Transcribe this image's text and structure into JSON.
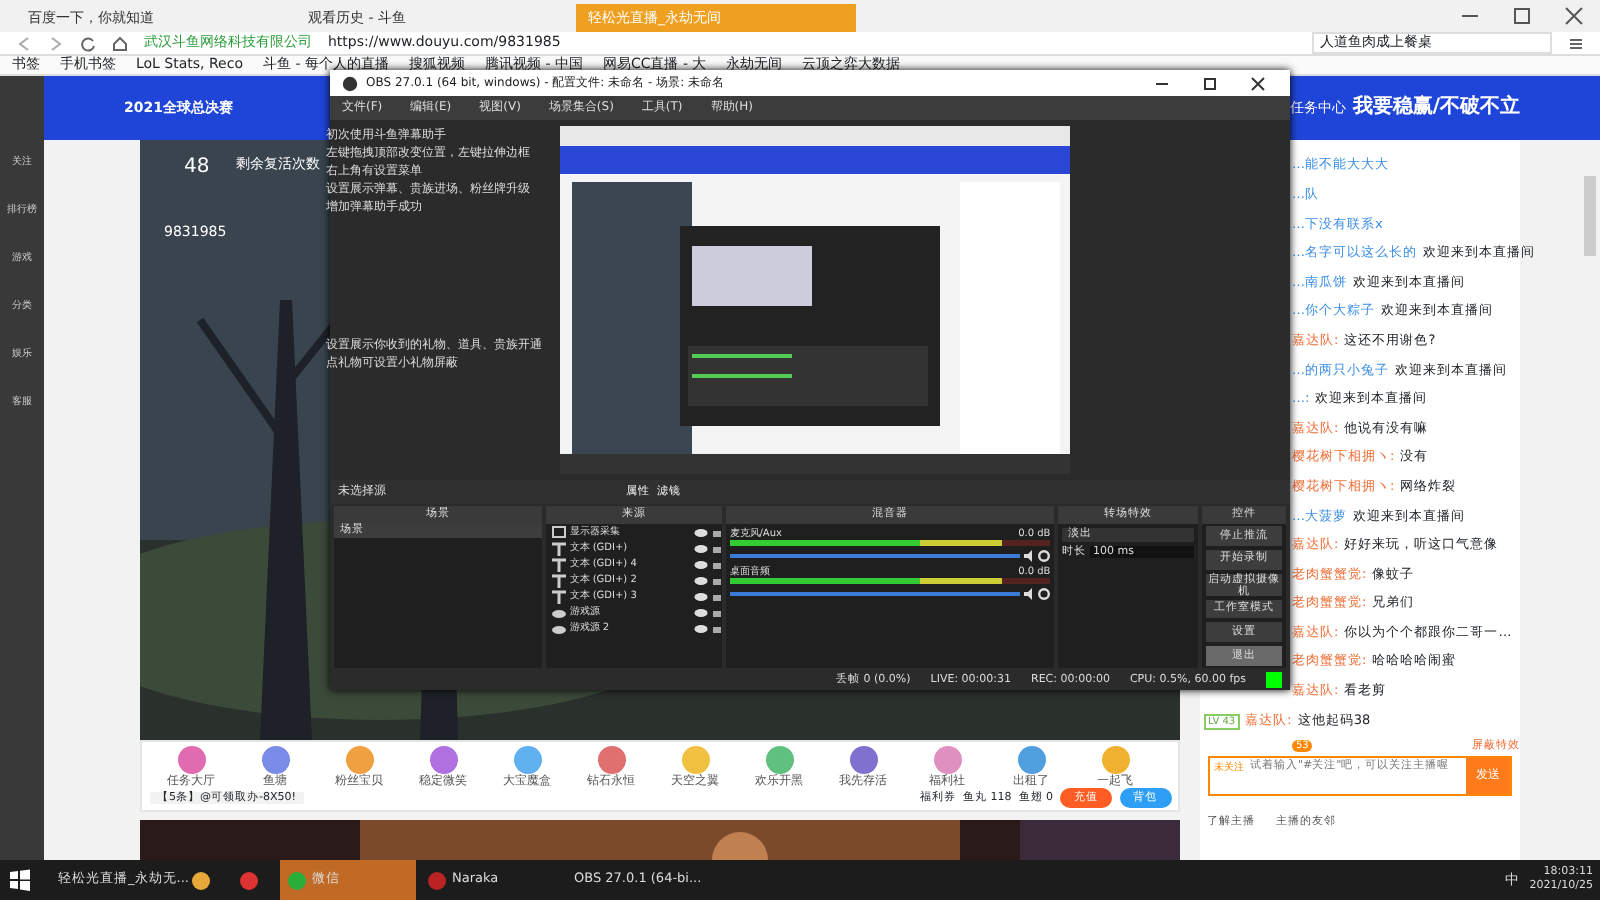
{
  "browser": {
    "tabs": [
      {
        "label": "百度一下，你就知道",
        "selected": false
      },
      {
        "label": "观看历史 - 斗鱼",
        "selected": false
      },
      {
        "label": "轻松光直播_永劫无间",
        "selected": true
      }
    ],
    "company": "武汉斗鱼网络科技有限公司",
    "url": "https://www.douyu.com/9831985",
    "search": "人道鱼肉成上餐桌",
    "bookmarks": [
      "书签",
      "手机书签",
      "LoL Stats, Reco",
      "斗鱼 - 每个人的直播",
      "搜狐视频",
      "腾讯视频 - 中国",
      "网易CC直播 - 大",
      "永劫无间",
      "云顶之弈大数据"
    ]
  },
  "sidebar": [
    "关注",
    "排行榜",
    "游戏",
    "分类",
    "娱乐",
    "客服"
  ],
  "banner": {
    "title": "2021全球总决赛",
    "slogan": "我要稳赢/不破不立",
    "task": "任务中心"
  },
  "video": {
    "count": "48",
    "room": "9831985",
    "lives": "剩余复活次数"
  },
  "helper_texts": [
    "初次使用斗鱼弹幕助手",
    "左键拖拽顶部改变位置，左键拉伸边框",
    "右上角有设置菜单",
    "设置展示弹幕、贵族进场、粉丝牌升级",
    "增加弹幕助手成功",
    "设置展示你收到的礼物、道具、贵族开通",
    "点礼物可设置小礼物屏蔽"
  ],
  "obs": {
    "title": "OBS 27.0.1 (64 bit, windows) - 配置文件: 未命名 - 场景: 未命名",
    "menu": [
      "文件(F)",
      "编辑(E)",
      "视图(V)",
      "场景集合(S)",
      "工具(T)",
      "帮助(H)"
    ],
    "no_source": "未选择源",
    "source_buttons": [
      "属性",
      "滤镜"
    ],
    "docks": {
      "scenes": "场景",
      "sources": "来源",
      "mixer": "混音器",
      "transitions": "转场特效",
      "controls": "控件"
    },
    "scenes": [
      {
        "name": "场景",
        "selected": true
      }
    ],
    "sources": [
      {
        "name": "显示器采集",
        "kind": "monitor"
      },
      {
        "name": "文本 (GDI+)",
        "kind": "text"
      },
      {
        "name": "文本 (GDI+) 4",
        "kind": "text"
      },
      {
        "name": "文本 (GDI+) 2",
        "kind": "text"
      },
      {
        "name": "文本 (GDI+) 3",
        "kind": "text"
      },
      {
        "name": "游戏源",
        "kind": "game"
      },
      {
        "name": "游戏源 2",
        "kind": "game"
      }
    ],
    "channels": [
      {
        "name": "麦克风/Aux",
        "reading": "0.0 dB",
        "level": 0.85,
        "fader": {
          "level": 1
        }
      },
      {
        "name": "桌面音频",
        "reading": "0.0 dB",
        "level": 0.85,
        "fader": {
          "level": 1
        }
      }
    ],
    "transition": "淡出",
    "duration_label": "时长",
    "duration": "100 ms",
    "controls": [
      {
        "label": "停止推流",
        "selected": false
      },
      {
        "label": "开始录制",
        "selected": false
      },
      {
        "label": "启动虚拟摄像机",
        "selected": false
      },
      {
        "label": "工作室模式",
        "selected": false
      },
      {
        "label": "设置",
        "selected": false
      },
      {
        "label": "退出",
        "selected": true
      }
    ],
    "status": [
      "丢帧 0 (0.0%)",
      "LIVE: 00:00:31",
      "REC: 00:00:00",
      "CPU: 0.5%, 60.00 fps"
    ]
  },
  "gifts": [
    "任务大厅",
    "鱼塘",
    "粉丝宝贝",
    "稳定微笑",
    "大宝魔盒",
    "钻石永恒",
    "天空之翼",
    "欢乐开黑",
    "我先存活",
    "福利社",
    "出租了",
    "一起飞"
  ],
  "player_bar": {
    "notice": "【5条】@可领取办-8X50!",
    "coupon": "福利券",
    "fishball": "鱼丸 118",
    "fishfin": "鱼翅 0",
    "recharge": "充值",
    "bag": "背包"
  },
  "chat": [
    {
      "kind": "welcome",
      "name": "…能不能大大大"
    },
    {
      "kind": "welcome",
      "name": "…队"
    },
    {
      "kind": "welcome",
      "name": "…下没有联系x"
    },
    {
      "kind": "welcome",
      "name": "…名字可以这么长的",
      "text": "欢迎来到本直播间"
    },
    {
      "kind": "welcome",
      "name": "…南瓜饼",
      "text": "欢迎来到本直播间"
    },
    {
      "kind": "welcome",
      "name": "…你个大粽子",
      "text": "欢迎来到本直播间"
    },
    {
      "kind": "message",
      "name": "嘉达队:",
      "text": "这还不用谢色?"
    },
    {
      "kind": "welcome",
      "name": "…的两只小兔子",
      "text": "欢迎来到本直播间"
    },
    {
      "kind": "welcome",
      "name": "…:",
      "text": "欢迎来到本直播间"
    },
    {
      "kind": "message",
      "name": "嘉达队:",
      "text": "他说有没有嘛"
    },
    {
      "kind": "message",
      "name": "樱花树下相拥ヽ:",
      "text": "没有"
    },
    {
      "kind": "message",
      "name": "樱花树下相拥ヽ:",
      "text": "网络炸裂"
    },
    {
      "kind": "welcome",
      "name": "…大菠萝",
      "text": "欢迎来到本直播间"
    },
    {
      "kind": "message",
      "name": "嘉达队:",
      "text": "好好来玩，听这口气意像"
    },
    {
      "kind": "message",
      "name": "老肉蟹蟹觉:",
      "text": "像蚊子"
    },
    {
      "kind": "message",
      "name": "老肉蟹蟹觉:",
      "text": "兄弟们"
    },
    {
      "kind": "message",
      "name": "嘉达队:",
      "text": "你以为个个都跟你二哥一…"
    },
    {
      "kind": "message",
      "name": "老肉蟹蟹觉:",
      "text": "哈哈哈哈闹蜜"
    },
    {
      "kind": "message",
      "name": "嘉达队:",
      "text": "看老剪"
    },
    {
      "kind": "message",
      "name": "嘉达队:",
      "text": "这他起码38",
      "level": "LV 43"
    }
  ],
  "chat_input": {
    "count": "53",
    "shield": "屏蔽特效",
    "follow": "未关注",
    "placeholder": "试着输入\"#关注\"吧，可以关注主播喔",
    "send": "发送"
  },
  "below": {
    "about": "了解主播",
    "friends": "主播的友邻"
  },
  "taskbar": {
    "apps": [
      {
        "label": "轻松光直播_永劫无...",
        "active": false
      },
      {
        "active": false
      },
      {
        "active": false
      },
      {
        "label": "微信",
        "active": true
      },
      {
        "label": "Naraka",
        "active": false
      },
      {
        "label": "OBS 27.0.1 (64-bi...",
        "active": false
      }
    ],
    "ime": "中",
    "time": "18:03:11",
    "date": "2021/10/25"
  }
}
